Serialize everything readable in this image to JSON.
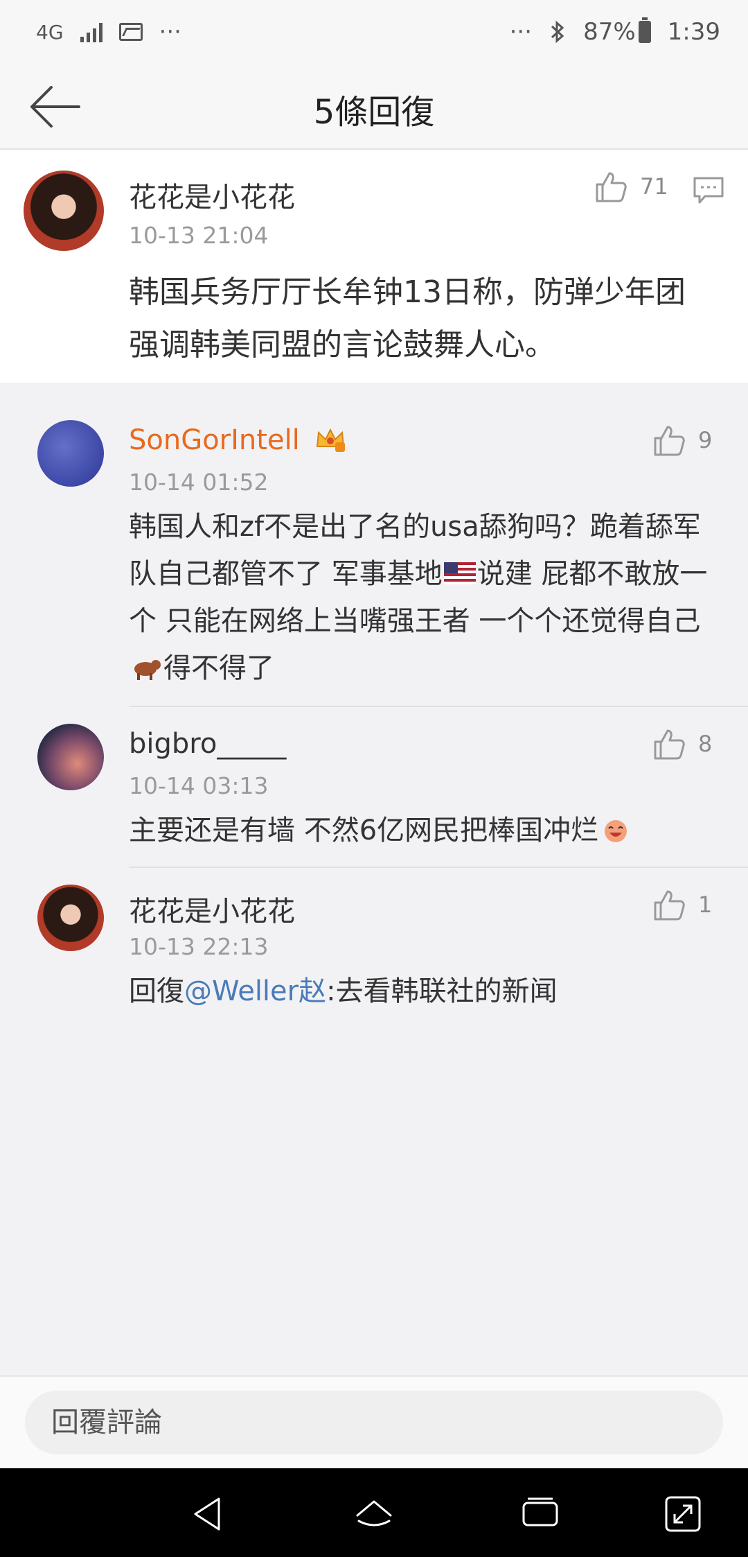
{
  "status_bar": {
    "network": "4G",
    "more_left": "···",
    "more_right": "···",
    "battery": "87%",
    "time": "1:39"
  },
  "header": {
    "title": "5條回復"
  },
  "top_comment": {
    "username": "花花是小花花",
    "time": "10-13 21:04",
    "likes": "71",
    "text": "韩国兵务厅厅长牟钟13日称，防弹少年团强调韩美同盟的言论鼓舞人心。"
  },
  "replies": [
    {
      "username": "SonGorIntell",
      "time": "10-14 01:52",
      "likes": "9",
      "text_parts": [
        "韩国人和zf不是出了名的usa舔狗吗？跪着舔军队自己都管不了 军事基地",
        "说建 屁都不敢放一个 只能在网络上当嘴强王者 一个个还觉得自己",
        "得不得了"
      ]
    },
    {
      "username": "bigbro_____",
      "time": "10-14 03:13",
      "likes": "8",
      "text": "主要还是有墙 不然6亿网民把棒国冲烂"
    },
    {
      "username": "花花是小花花",
      "time": "10-13 22:13",
      "likes": "1",
      "text_prefix": "回復",
      "mention": "@Weller赵",
      "text_suffix": ":去看韩联社的新闻"
    }
  ],
  "input": {
    "placeholder": "回覆評論"
  },
  "colors": {
    "vip_name": "#e86a1c",
    "mention": "#4a7bb7",
    "background": "#f2f2f5"
  }
}
